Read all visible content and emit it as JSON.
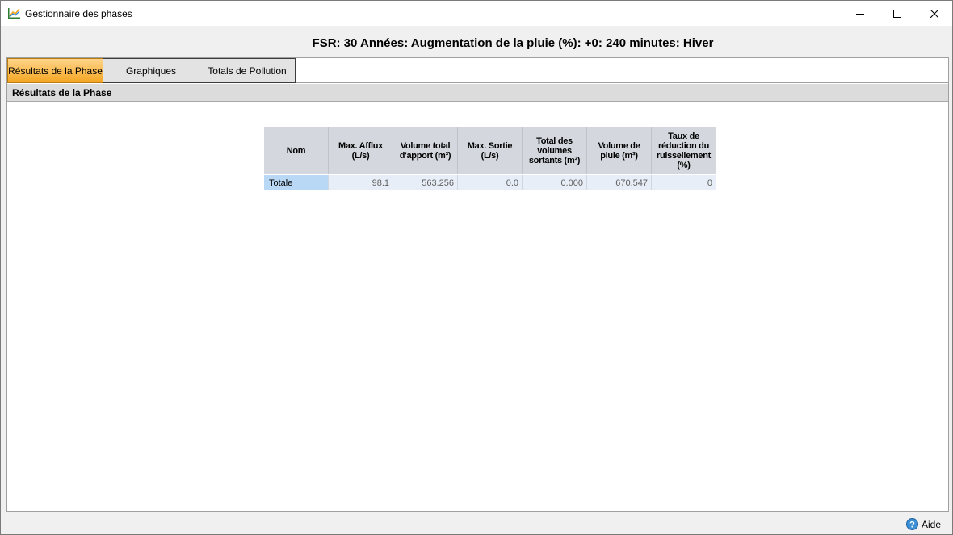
{
  "window": {
    "title": "Gestionnaire des phases",
    "icon": "app-chart-icon"
  },
  "header": {
    "caption": "FSR: 30 Années: Augmentation de la pluie (%): +0: 240 minutes: Hiver"
  },
  "tabs": [
    {
      "label": "Résultats de la Phase",
      "active": true
    },
    {
      "label": "Graphiques",
      "active": false
    },
    {
      "label": "Totals de Pollution",
      "active": false
    }
  ],
  "section": {
    "title": "Résultats de la Phase"
  },
  "table": {
    "columns": [
      "Nom",
      "Max. Afflux (L/s)",
      "Volume total d'apport (m³)",
      "Max. Sortie (L/s)",
      "Total des volumes sortants (m³)",
      "Volume de pluie (m³)",
      "Taux de réduction du ruissellement (%)"
    ],
    "rows": [
      [
        "Totale",
        "98.1",
        "563.256",
        "0.0",
        "0.000",
        "670.547",
        "0"
      ]
    ]
  },
  "footer": {
    "help_label": "Aide",
    "help_icon": "help-icon"
  },
  "colors": {
    "active_tab": "#f5a623",
    "header_cell": "#d4d8de",
    "name_cell": "#b8d8f5",
    "value_cell": "#e8eef7"
  }
}
